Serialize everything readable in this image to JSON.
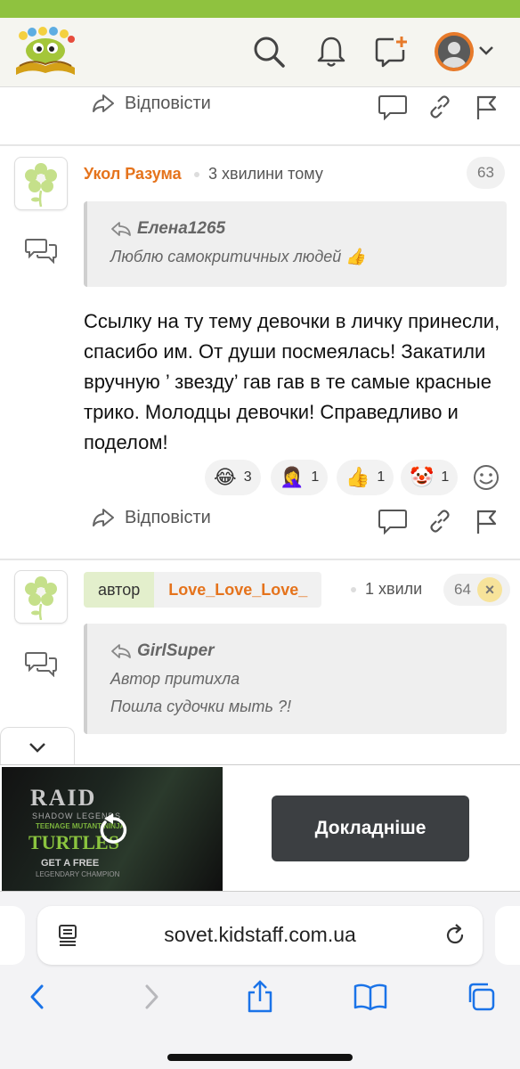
{
  "header": {
    "logo": "kidstaff-logo",
    "icons": [
      "search-icon",
      "bell-icon",
      "new-message-icon",
      "user-avatar",
      "chevron-down-icon"
    ]
  },
  "actions": {
    "reply_label": "Відповісти"
  },
  "comments": [
    {
      "author": "Укол Разума",
      "time": "3 хвилини тому",
      "number": "63",
      "quote": {
        "author": "Елена1265",
        "lines": [
          "Люблю самокритичных людей 👍"
        ]
      },
      "body": "Ссылку на ту тему девочки в личку принесли, спасибо им. От души посмеялась! Закатили вручную ’ звезду’ гав гав в те самые красные трико. Молодцы девочки! Справедливо и поделом!",
      "reactions": [
        {
          "emoji": "😂",
          "count": "3"
        },
        {
          "emoji": "🤦‍♀️",
          "count": "1"
        },
        {
          "emoji": "👍",
          "count": "1"
        },
        {
          "emoji": "🤡",
          "count": "1"
        }
      ]
    },
    {
      "tag": "автор",
      "author": "Love_Love_Love_",
      "time": "1 хвили",
      "number": "64",
      "close_label": "×",
      "quote": {
        "author": "GirlSuper",
        "lines": [
          "Автор притихла",
          "Пошла судочки мыть ?!"
        ]
      }
    }
  ],
  "ad": {
    "title": "RAID",
    "subtitle": "SHADOW LEGENDS",
    "tmnt_small": "TEENAGE MUTANT NINJA",
    "tmnt": "TURTLES",
    "offer": "GET A FREE",
    "offer_sub": "LEGENDARY CHAMPION",
    "cta": "Докладніше"
  },
  "browser": {
    "url": "sovet.kidstaff.com.ua",
    "icons": [
      "reader-icon",
      "reload-icon",
      "back-icon",
      "forward-icon",
      "share-icon",
      "bookmarks-icon",
      "tabs-icon"
    ]
  },
  "colors": {
    "accent_green": "#8fc23f",
    "author_orange": "#e5731c",
    "ios_blue": "#1a73e8"
  }
}
